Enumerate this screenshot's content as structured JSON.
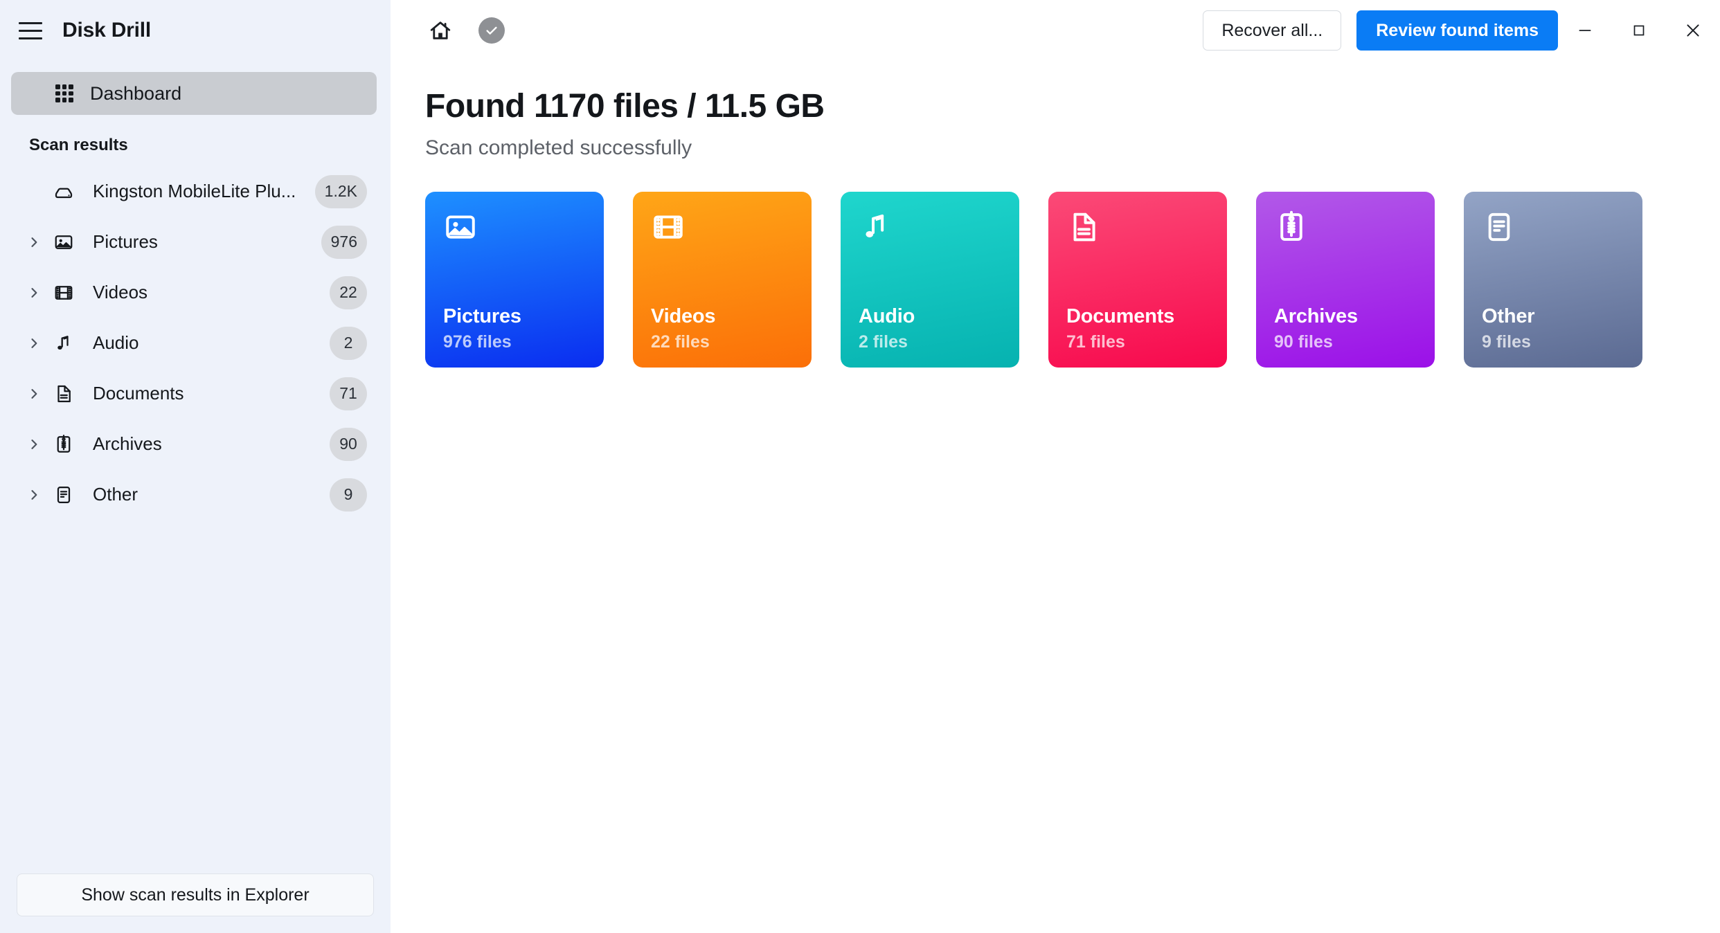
{
  "app": {
    "title": "Disk Drill"
  },
  "sidebar": {
    "menu_icon": "hamburger-icon",
    "nav": {
      "dashboard_label": "Dashboard",
      "dashboard_icon": "grid-icon"
    },
    "section_title": "Scan results",
    "tree": [
      {
        "label": "Kingston MobileLite Plu...",
        "badge": "1.2K",
        "icon": "disk-icon",
        "has_chevron": false
      },
      {
        "label": "Pictures",
        "badge": "976",
        "icon": "image-icon",
        "has_chevron": true
      },
      {
        "label": "Videos",
        "badge": "22",
        "icon": "film-icon",
        "has_chevron": true
      },
      {
        "label": "Audio",
        "badge": "2",
        "icon": "music-note-icon",
        "has_chevron": true
      },
      {
        "label": "Documents",
        "badge": "71",
        "icon": "document-icon",
        "has_chevron": true
      },
      {
        "label": "Archives",
        "badge": "90",
        "icon": "zip-icon",
        "has_chevron": true
      },
      {
        "label": "Other",
        "badge": "9",
        "icon": "file-lines-icon",
        "has_chevron": true
      }
    ],
    "footer_button": "Show scan results in Explorer"
  },
  "topbar": {
    "home_icon": "home-icon",
    "status_icon": "check-circle-icon",
    "recover_all_label": "Recover all...",
    "review_label": "Review found items",
    "minimize_label": "Minimize",
    "maximize_label": "Maximize",
    "close_label": "Close"
  },
  "main": {
    "headline": "Found 1170 files / 11.5 GB",
    "subline": "Scan completed successfully"
  },
  "cards": [
    {
      "title": "Pictures",
      "count": "976 files",
      "icon": "image-icon",
      "from": "#1e90ff",
      "to": "#0a2df0"
    },
    {
      "title": "Videos",
      "count": "22 files",
      "icon": "film-icon",
      "from": "#ffa617",
      "to": "#fb6f08"
    },
    {
      "title": "Audio",
      "count": "2 files",
      "icon": "music-note-icon",
      "from": "#1fd6cd",
      "to": "#06b2b0"
    },
    {
      "title": "Documents",
      "count": "71 files",
      "icon": "document-icon",
      "from": "#fb4a77",
      "to": "#f8094d"
    },
    {
      "title": "Archives",
      "count": "90 files",
      "icon": "zip-icon",
      "from": "#b259e8",
      "to": "#9b10e8"
    },
    {
      "title": "Other",
      "count": "9 files",
      "icon": "file-lines-icon",
      "from": "#93a4c6",
      "to": "#5b6a92"
    }
  ],
  "colors": {
    "accent": "#0a7cf5",
    "sidebar_bg": "#eef2fa",
    "selected_bg": "#c9ccd1",
    "badge_bg": "#d8dade"
  }
}
